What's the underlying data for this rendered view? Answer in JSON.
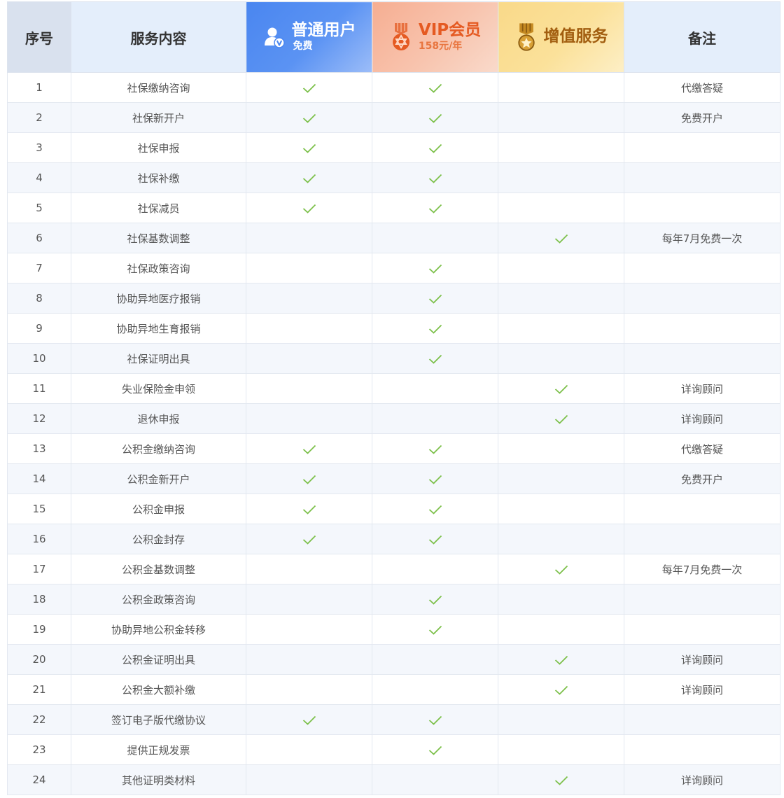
{
  "header": {
    "index": "序号",
    "service": "服务内容",
    "basic": {
      "title": "普通用户",
      "sub": "免费",
      "icon": "user-icon"
    },
    "vip": {
      "title": "VIP会员",
      "sub": "158元/年",
      "icon": "medal-icon"
    },
    "addon": {
      "title": "增值服务",
      "icon": "gold-medal-icon"
    },
    "remark": "备注"
  },
  "colors": {
    "check": "#7cc04a",
    "basic": "#4a86f0",
    "vip": "#e55a22",
    "addon": "#a25e10"
  },
  "rows": [
    {
      "idx": "1",
      "service": "社保缴纳咨询",
      "basic": true,
      "vip": true,
      "addon": false,
      "remark": "代缴答疑"
    },
    {
      "idx": "2",
      "service": "社保新开户",
      "basic": true,
      "vip": true,
      "addon": false,
      "remark": "免费开户"
    },
    {
      "idx": "3",
      "service": "社保申报",
      "basic": true,
      "vip": true,
      "addon": false,
      "remark": ""
    },
    {
      "idx": "4",
      "service": "社保补缴",
      "basic": true,
      "vip": true,
      "addon": false,
      "remark": ""
    },
    {
      "idx": "5",
      "service": "社保减员",
      "basic": true,
      "vip": true,
      "addon": false,
      "remark": ""
    },
    {
      "idx": "6",
      "service": "社保基数调整",
      "basic": false,
      "vip": false,
      "addon": true,
      "remark": "每年7月免费一次"
    },
    {
      "idx": "7",
      "service": "社保政策咨询",
      "basic": false,
      "vip": true,
      "addon": false,
      "remark": ""
    },
    {
      "idx": "8",
      "service": "协助异地医疗报销",
      "basic": false,
      "vip": true,
      "addon": false,
      "remark": ""
    },
    {
      "idx": "9",
      "service": "协助异地生育报销",
      "basic": false,
      "vip": true,
      "addon": false,
      "remark": ""
    },
    {
      "idx": "10",
      "service": "社保证明出具",
      "basic": false,
      "vip": true,
      "addon": false,
      "remark": ""
    },
    {
      "idx": "11",
      "service": "失业保险金申领",
      "basic": false,
      "vip": false,
      "addon": true,
      "remark": "详询顾问"
    },
    {
      "idx": "12",
      "service": "退休申报",
      "basic": false,
      "vip": false,
      "addon": true,
      "remark": "详询顾问"
    },
    {
      "idx": "13",
      "service": "公积金缴纳咨询",
      "basic": true,
      "vip": true,
      "addon": false,
      "remark": "代缴答疑"
    },
    {
      "idx": "14",
      "service": "公积金新开户",
      "basic": true,
      "vip": true,
      "addon": false,
      "remark": "免费开户"
    },
    {
      "idx": "15",
      "service": "公积金申报",
      "basic": true,
      "vip": true,
      "addon": false,
      "remark": ""
    },
    {
      "idx": "16",
      "service": "公积金封存",
      "basic": true,
      "vip": true,
      "addon": false,
      "remark": ""
    },
    {
      "idx": "17",
      "service": "公积金基数调整",
      "basic": false,
      "vip": false,
      "addon": true,
      "remark": "每年7月免费一次"
    },
    {
      "idx": "18",
      "service": "公积金政策咨询",
      "basic": false,
      "vip": true,
      "addon": false,
      "remark": ""
    },
    {
      "idx": "19",
      "service": "协助异地公积金转移",
      "basic": false,
      "vip": true,
      "addon": false,
      "remark": ""
    },
    {
      "idx": "20",
      "service": "公积金证明出具",
      "basic": false,
      "vip": false,
      "addon": true,
      "remark": "详询顾问"
    },
    {
      "idx": "21",
      "service": "公积金大额补缴",
      "basic": false,
      "vip": false,
      "addon": true,
      "remark": "详询顾问"
    },
    {
      "idx": "22",
      "service": "签订电子版代缴协议",
      "basic": true,
      "vip": true,
      "addon": false,
      "remark": ""
    },
    {
      "idx": "23",
      "service": "提供正规发票",
      "basic": false,
      "vip": true,
      "addon": false,
      "remark": ""
    },
    {
      "idx": "24",
      "service": "其他证明类材料",
      "basic": false,
      "vip": false,
      "addon": true,
      "remark": "详询顾问"
    }
  ]
}
